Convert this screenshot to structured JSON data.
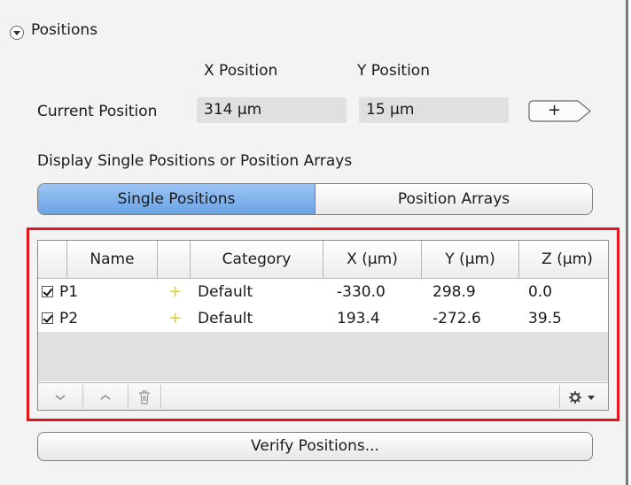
{
  "section": {
    "title": "Positions"
  },
  "position": {
    "x_header": "X Position",
    "y_header": "Y Position",
    "current_label": "Current Position",
    "x_value": "314 µm",
    "y_value": "15 µm",
    "add_label": "+"
  },
  "display": {
    "label": "Display Single Positions or Position Arrays",
    "tabs": [
      {
        "label": "Single Positions",
        "active": true
      },
      {
        "label": "Position Arrays",
        "active": false
      }
    ]
  },
  "table": {
    "columns": [
      "Name",
      "Category",
      "X (µm)",
      "Y (µm)",
      "Z (µm)"
    ],
    "rows": [
      {
        "checked": true,
        "name": "P1",
        "marker": "+",
        "category": "Default",
        "x": "-330.0",
        "y": "298.9",
        "z": "0.0"
      },
      {
        "checked": true,
        "name": "P2",
        "marker": "+",
        "category": "Default",
        "x": "193.4",
        "y": "-272.6",
        "z": "39.5"
      }
    ],
    "footer": {
      "icons": [
        "chevron-down-icon",
        "chevron-up-icon",
        "trash-icon",
        "gear-icon"
      ]
    }
  },
  "verify": {
    "label": "Verify Positions..."
  },
  "colors": {
    "active_tab": "#7fb2ec",
    "highlight": "#e8141c",
    "marker": "#e6d200"
  }
}
